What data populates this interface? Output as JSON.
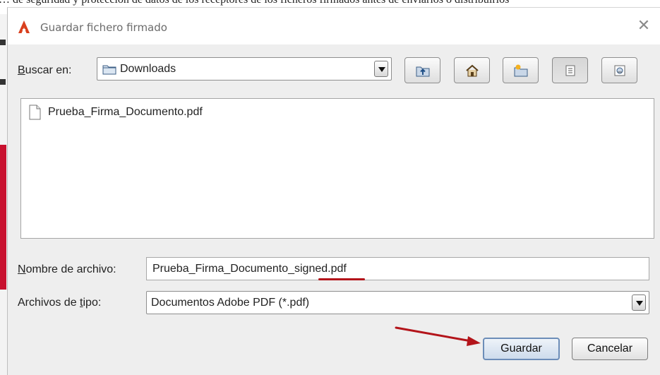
{
  "background": {
    "document_text": "… de seguridad y protección de datos de los receptores de los ficheros firmados antes de enviarlos o distribuirlos"
  },
  "dialog": {
    "title": "Guardar fichero firmado",
    "close_label": "✕",
    "look_in": {
      "label_mnemonic": "B",
      "label_rest": "uscar en:",
      "value": "Downloads"
    },
    "toolbar": {
      "buttons": [
        {
          "name": "up-one-level",
          "icon": "folder-up-icon"
        },
        {
          "name": "home",
          "icon": "home-icon"
        },
        {
          "name": "new-folder",
          "icon": "new-folder-icon"
        },
        {
          "name": "list-view",
          "icon": "list-view-icon",
          "pressed": true
        },
        {
          "name": "details-view",
          "icon": "details-view-icon"
        }
      ]
    },
    "files": [
      {
        "name": "Prueba_Firma_Documento.pdf",
        "icon": "file-icon"
      }
    ],
    "file_name": {
      "label_mnemonic": "N",
      "label_rest": "ombre de archivo:",
      "value": "Prueba_Firma_Documento_signed.pdf"
    },
    "file_type": {
      "label_before": "Archivos de ",
      "label_mnemonic": "t",
      "label_after": "ipo:",
      "value": "Documentos Adobe PDF (*.pdf)"
    },
    "buttons": {
      "save": "Guardar",
      "cancel": "Cancelar"
    }
  },
  "colors": {
    "annotation": "#b3141a",
    "dialog_bg": "#eeeeee"
  }
}
